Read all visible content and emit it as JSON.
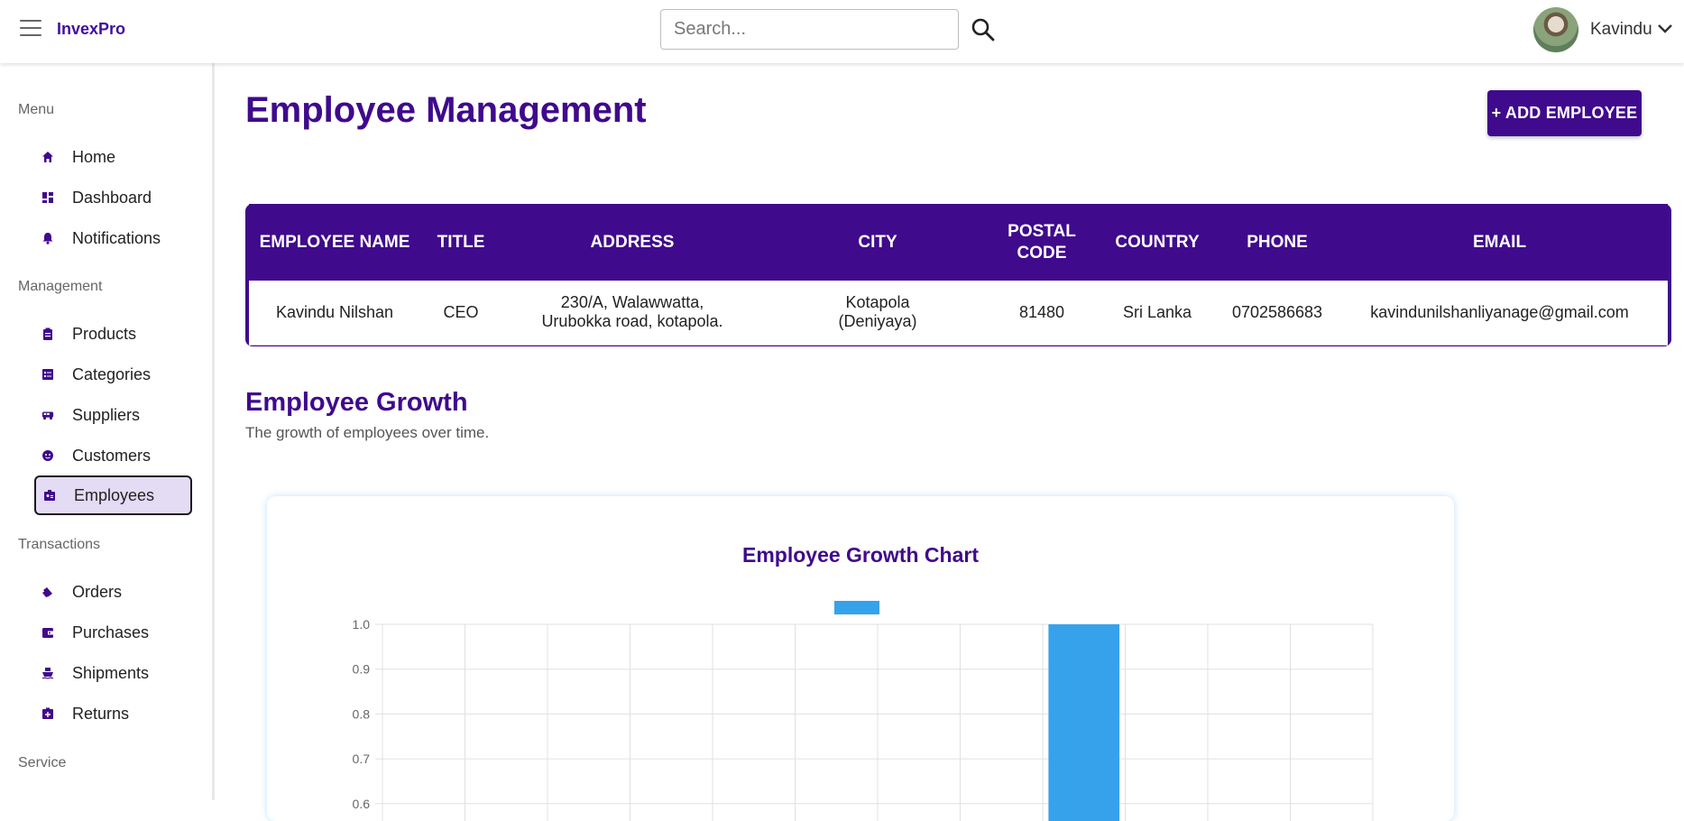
{
  "app": {
    "brand": "InvexPro"
  },
  "search": {
    "placeholder": "Search..."
  },
  "user": {
    "name": "Kavindu"
  },
  "sidebar": {
    "sections": [
      {
        "label": "Menu",
        "items": [
          {
            "label": "Home",
            "icon": "home-icon"
          },
          {
            "label": "Dashboard",
            "icon": "dashboard-icon"
          },
          {
            "label": "Notifications",
            "icon": "bell-icon"
          }
        ]
      },
      {
        "label": "Management",
        "items": [
          {
            "label": "Products",
            "icon": "clipboard-icon"
          },
          {
            "label": "Categories",
            "icon": "list-icon"
          },
          {
            "label": "Suppliers",
            "icon": "truck-icon"
          },
          {
            "label": "Customers",
            "icon": "face-icon"
          },
          {
            "label": "Employees",
            "icon": "badge-icon",
            "active": true
          }
        ]
      },
      {
        "label": "Transactions",
        "items": [
          {
            "label": "Orders",
            "icon": "shopping-icon"
          },
          {
            "label": "Purchases",
            "icon": "wallet-icon"
          },
          {
            "label": "Shipments",
            "icon": "ship-icon"
          },
          {
            "label": "Returns",
            "icon": "return-icon"
          }
        ]
      },
      {
        "label": "Service",
        "items": []
      }
    ]
  },
  "page": {
    "title": "Employee Management",
    "add_button": "+ ADD EMPLOYEE"
  },
  "table": {
    "headers": [
      "EMPLOYEE NAME",
      "TITLE",
      "ADDRESS",
      "CITY",
      "POSTAL CODE",
      "COUNTRY",
      "PHONE",
      "EMAIL"
    ],
    "rows": [
      [
        "Kavindu Nilshan",
        "CEO",
        "230/A, Walawwatta, Urubokka road, kotapola.",
        "Kotapola (Deniyaya)",
        "81480",
        "Sri Lanka",
        "0702586683",
        "kavindunilshanliyanage@gmail.com"
      ]
    ]
  },
  "growth": {
    "title": "Employee Growth",
    "subtitle": "The growth of employees over time."
  },
  "colors": {
    "accent": "#3f0a8c",
    "bar": "#36a2eb",
    "active_bg": "#e4dbf5"
  },
  "chart_data": {
    "type": "bar",
    "title": "Employee Growth Chart",
    "categories": [
      "",
      "",
      "",
      "",
      "",
      "",
      "",
      "",
      "",
      "",
      "",
      ""
    ],
    "series": [
      {
        "values": [
          0,
          0,
          0,
          0,
          0,
          0,
          0,
          0,
          1,
          0,
          0,
          0
        ]
      }
    ],
    "ylim": [
      0,
      1.0
    ],
    "yticks": [
      1.0,
      0.9,
      0.8,
      0.7,
      0.6
    ],
    "grid": true,
    "legend": "top"
  }
}
